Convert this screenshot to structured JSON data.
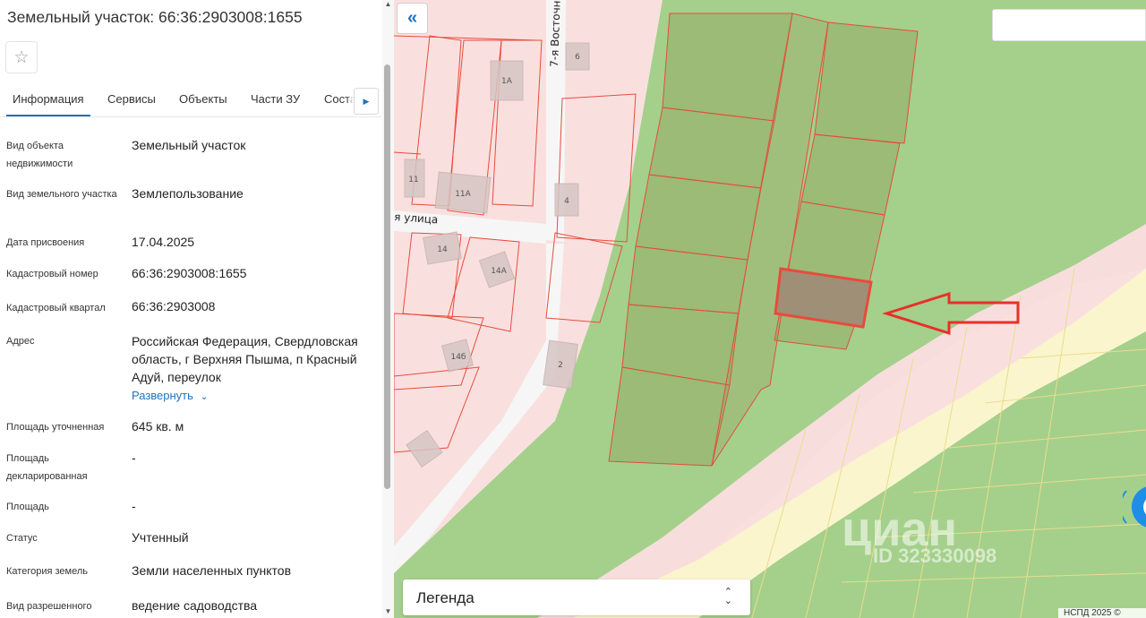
{
  "panel": {
    "title": "Земельный участок: 66:36:2903008:1655",
    "favorite_icon": "star-outline-icon",
    "tabs": [
      {
        "label": "Информация",
        "active": true
      },
      {
        "label": "Сервисы"
      },
      {
        "label": "Объекты"
      },
      {
        "label": "Части ЗУ"
      },
      {
        "label": "Состав"
      }
    ],
    "tabs_more_icon": "chevron-right-icon",
    "fields": [
      {
        "label": "Вид объекта недвижимости",
        "value": "Земельный участок"
      },
      {
        "label": "Вид земельного участка",
        "value": "Землепользование"
      },
      {
        "label": "Дата присвоения",
        "value": "17.04.2025"
      },
      {
        "label": "Кадастровый номер",
        "value": "66:36:2903008:1655"
      },
      {
        "label": "Кадастровый квартал",
        "value": "66:36:2903008"
      },
      {
        "label": "Адрес",
        "value": "Российская Федерация, Свердловская область, г Верхняя Пышма, п Красный Адуй, переулок"
      },
      {
        "label": "Площадь уточненная",
        "value": "645 кв. м"
      },
      {
        "label": "Площадь декларированная",
        "value": "-"
      },
      {
        "label": "Площадь",
        "value": "-"
      },
      {
        "label": "Статус",
        "value": "Учтенный"
      },
      {
        "label": "Категория земель",
        "value": "Земли населенных пунктов"
      },
      {
        "label": "Вид разрешенного",
        "value": "ведение садоводства"
      }
    ],
    "expand_label": "Развернуть",
    "expand_icon": "chevron-down-icon"
  },
  "map": {
    "collapse_icon": "double-chevron-left-icon",
    "search_value": "",
    "street_labels": [
      "7-я Восточн",
      "я улица"
    ],
    "parcel_labels": [
      "6",
      "1А",
      "11",
      "11А",
      "4",
      "14",
      "14А",
      "14б",
      "2"
    ],
    "legend_label": "Легенда",
    "legend_icon": "sort-arrows-icon",
    "copyright": "НСПД 2025 ©",
    "watermark_logo": "циан",
    "watermark_id": "ID 323330098",
    "annotation_icon": "red-arrow-left-icon",
    "chat_icon": "chat-bubble-icon"
  },
  "colors": {
    "accent": "#1e73be",
    "parcel_outline": "#e84b3c",
    "highlighted_parcel": "#9e8f76",
    "green_zone": "#9fcf85",
    "pink_zone": "#f9e0df",
    "yellow_zone": "#fbf5cd"
  }
}
